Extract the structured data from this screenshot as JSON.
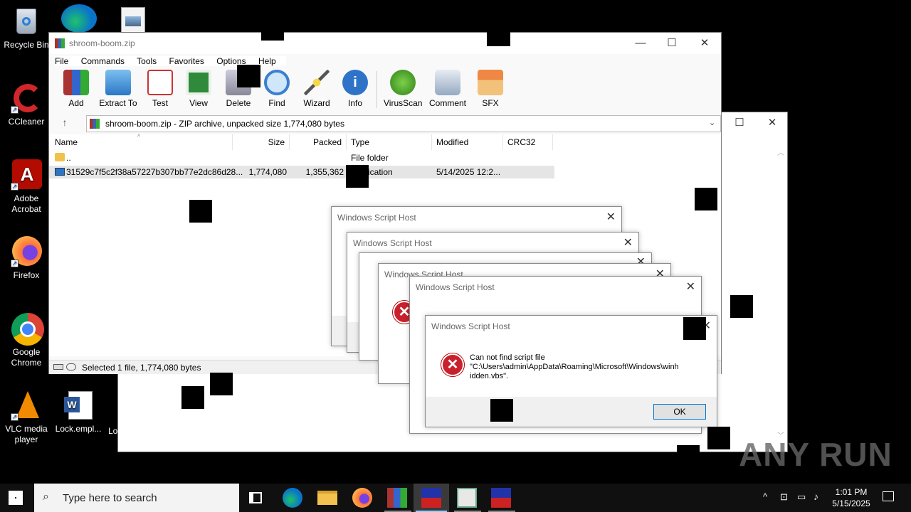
{
  "desktop": {
    "icons": [
      {
        "label": "Recycle Bin"
      },
      {
        "label": "CCleaner"
      },
      {
        "label": "Adobe Acrobat"
      },
      {
        "label": "Firefox"
      },
      {
        "label": "Google Chrome"
      },
      {
        "label": "VLC media player"
      },
      {
        "label": "Lock.empl..."
      },
      {
        "label": "Lo"
      }
    ]
  },
  "winrar": {
    "title": "shroom-boom.zip",
    "menu": [
      "File",
      "Commands",
      "Tools",
      "Favorites",
      "Options",
      "Help"
    ],
    "toolbar": [
      "Add",
      "Extract To",
      "Test",
      "View",
      "Delete",
      "Find",
      "Wizard",
      "Info",
      "VirusScan",
      "Comment",
      "SFX"
    ],
    "path": "shroom-boom.zip - ZIP archive, unpacked size 1,774,080 bytes",
    "columns": [
      "Name",
      "Size",
      "Packed",
      "Type",
      "Modified",
      "CRC32"
    ],
    "rows": [
      {
        "name": "..",
        "size": "",
        "packed": "",
        "type": "File folder",
        "modified": "",
        "crc": ""
      },
      {
        "name": "31529c7f5c2f38a57227b307bb77e2dc86d28...",
        "size": "1,774,080",
        "packed": "1,355,362",
        "type": "ication",
        "modified": "5/14/2025 12:2...",
        "crc": ""
      }
    ],
    "status": "Selected 1 file, 1,774,080 bytes"
  },
  "dialogs": {
    "title": "Windows Script Host",
    "message_line1": "Can not find script file",
    "message_line2": "\"C:\\Users\\admin\\AppData\\Roaming\\Microsoft\\Windows\\winh",
    "message_line3": "idden.vbs\".",
    "ok_label": "OK"
  },
  "taskbar": {
    "search_placeholder": "Type here to search",
    "time": "1:01 PM",
    "date": "5/15/2025"
  },
  "watermark": "ANY RUN",
  "colors": {
    "selection": "#e5e5e5",
    "error": "#c8202c",
    "taskbar": "#101010"
  }
}
